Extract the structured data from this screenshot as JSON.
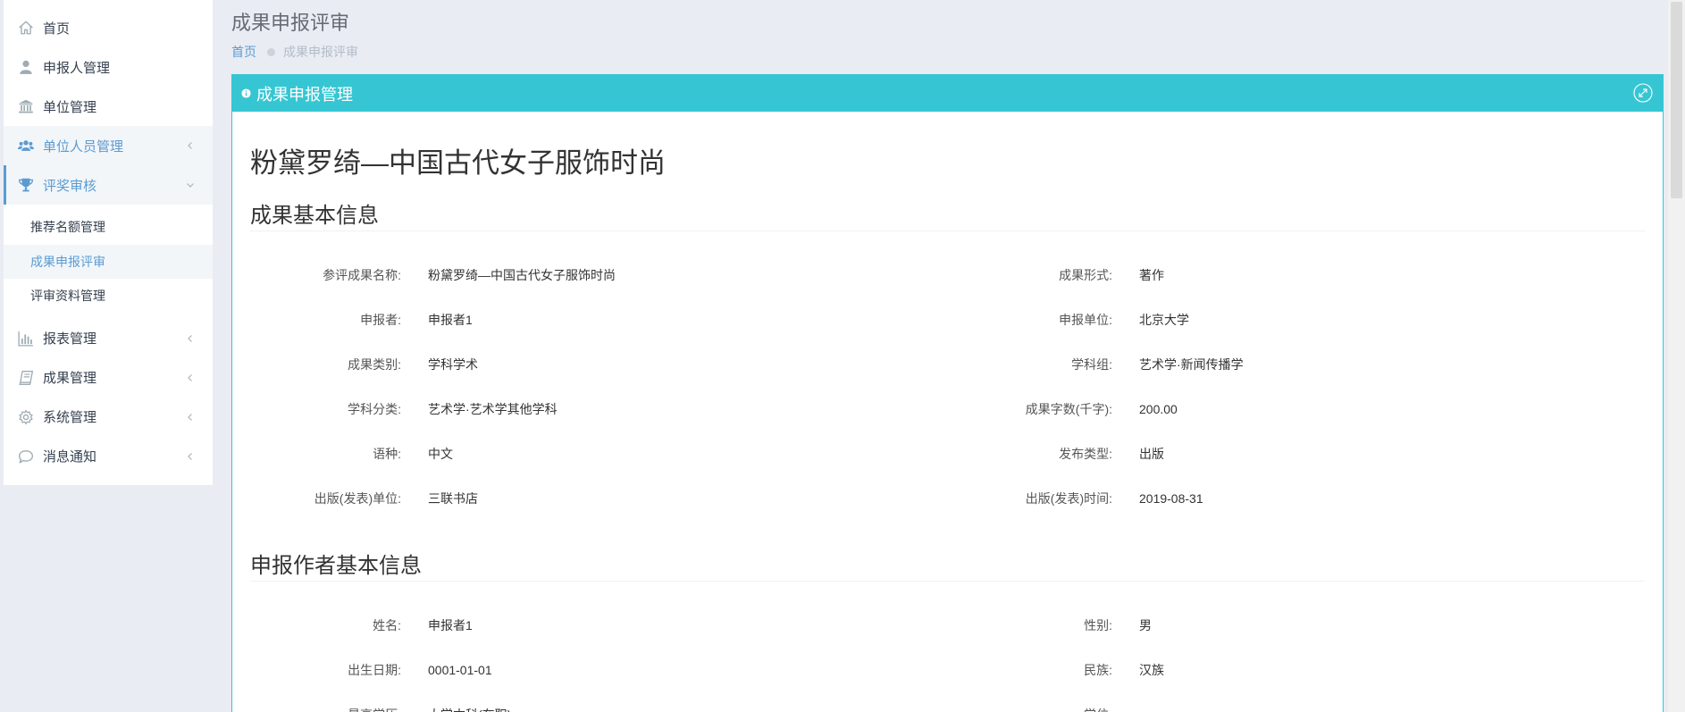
{
  "page": {
    "title": "成果申报评审",
    "breadcrumb": {
      "home": "首页",
      "current": "成果申报评审"
    }
  },
  "sidebar": {
    "items": [
      {
        "label": "首页",
        "icon": "home-icon"
      },
      {
        "label": "申报人管理",
        "icon": "user-icon"
      },
      {
        "label": "单位管理",
        "icon": "bank-icon"
      },
      {
        "label": "单位人员管理",
        "icon": "users-icon",
        "expandable": true
      },
      {
        "label": "评奖审核",
        "icon": "trophy-icon",
        "expanded": true,
        "children": [
          {
            "label": "推荐名额管理"
          },
          {
            "label": "成果申报评审",
            "active": true
          },
          {
            "label": "评审资料管理"
          }
        ]
      },
      {
        "label": "报表管理",
        "icon": "bar-chart-icon",
        "expandable": true
      },
      {
        "label": "成果管理",
        "icon": "book-icon",
        "expandable": true
      },
      {
        "label": "系统管理",
        "icon": "gear-icon",
        "expandable": true
      },
      {
        "label": "消息通知",
        "icon": "comment-icon",
        "expandable": true
      }
    ]
  },
  "panel": {
    "title": "成果申报管理",
    "title_icon": "info-icon",
    "action_icon": "expand-icon",
    "work_title": "粉黛罗绮—中国古代女子服饰时尚",
    "sections": [
      {
        "title": "成果基本信息",
        "rows": [
          [
            {
              "label": "参评成果名称:",
              "value": "粉黛罗绮—中国古代女子服饰时尚"
            },
            {
              "label": "成果形式:",
              "value": "著作"
            }
          ],
          [
            {
              "label": "申报者:",
              "value": "申报者1"
            },
            {
              "label": "申报单位:",
              "value": "北京大学"
            }
          ],
          [
            {
              "label": "成果类别:",
              "value": "学科学术"
            },
            {
              "label": "学科组:",
              "value": "艺术学·新闻传播学"
            }
          ],
          [
            {
              "label": "学科分类:",
              "value": "艺术学·艺术学其他学科"
            },
            {
              "label": "成果字数(千字):",
              "value": "200.00"
            }
          ],
          [
            {
              "label": "语种:",
              "value": "中文"
            },
            {
              "label": "发布类型:",
              "value": "出版"
            }
          ],
          [
            {
              "label": "出版(发表)单位:",
              "value": "三联书店"
            },
            {
              "label": "出版(发表)时间:",
              "value": "2019-08-31"
            }
          ]
        ]
      },
      {
        "title": "申报作者基本信息",
        "rows": [
          [
            {
              "label": "姓名:",
              "value": "申报者1"
            },
            {
              "label": "性别:",
              "value": "男"
            }
          ],
          [
            {
              "label": "出生日期:",
              "value": "0001-01-01"
            },
            {
              "label": "民族:",
              "value": "汉族"
            }
          ],
          [
            {
              "label": "最高学历:",
              "value": "大学本科(在职)"
            },
            {
              "label": "学位:"
            }
          ]
        ]
      }
    ]
  },
  "colors": {
    "accent": "#5b9bd1",
    "panel_header": "#36c6d3",
    "page_background": "#e9ecf3",
    "sidebar_background": "#ffffff"
  }
}
